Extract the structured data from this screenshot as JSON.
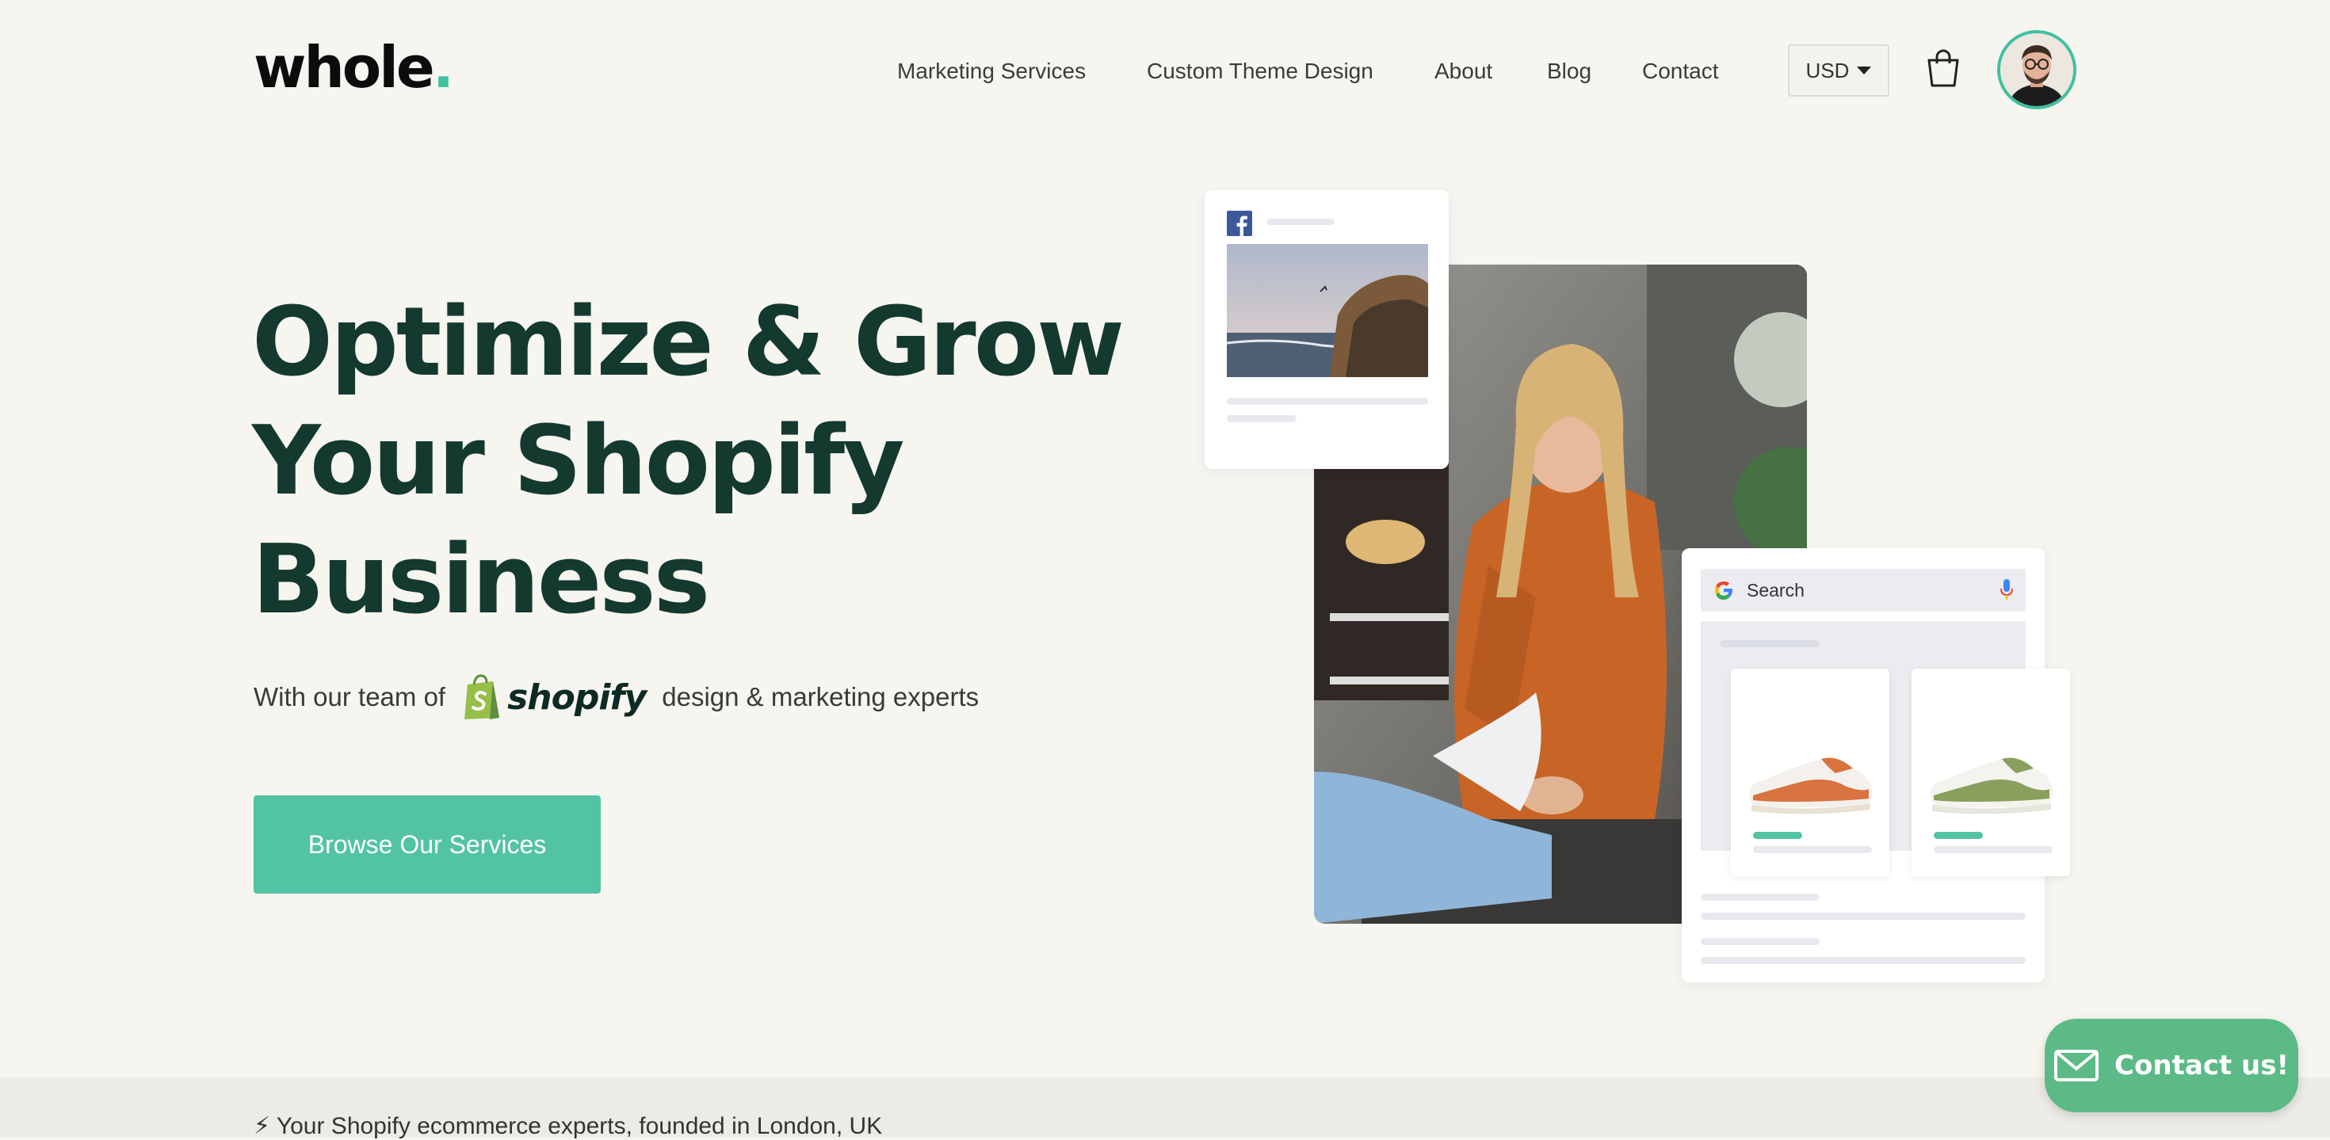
{
  "header": {
    "logo_text": "whole",
    "logo_dot": ".",
    "nav": [
      {
        "label": "Marketing Services"
      },
      {
        "label": "Custom Theme Design"
      },
      {
        "label": "About"
      },
      {
        "label": "Blog"
      },
      {
        "label": "Contact"
      }
    ],
    "currency": "USD",
    "cart_icon": "shopping-bag-icon",
    "avatar_icon": "account-avatar"
  },
  "hero": {
    "title_lines": [
      "Optimize & Grow",
      "Your Shopify",
      "Business"
    ],
    "subtitle_prefix": "With our team of",
    "shopify_wordmark": "shopify",
    "subtitle_suffix": "design & marketing experts",
    "cta_label": "Browse Our Services"
  },
  "visual": {
    "search_placeholder": "Search",
    "icons": [
      "facebook-icon",
      "google-icon",
      "microphone-icon"
    ]
  },
  "tagline": "⚡ Your Shopify ecommerce experts, founded in London, UK",
  "contact_widget": {
    "label": "Contact us!",
    "icon": "envelope-icon"
  },
  "colors": {
    "background": "#f6f5f0",
    "accent": "#52c4a3",
    "heading": "#14392f",
    "contact": "#5cba86"
  }
}
